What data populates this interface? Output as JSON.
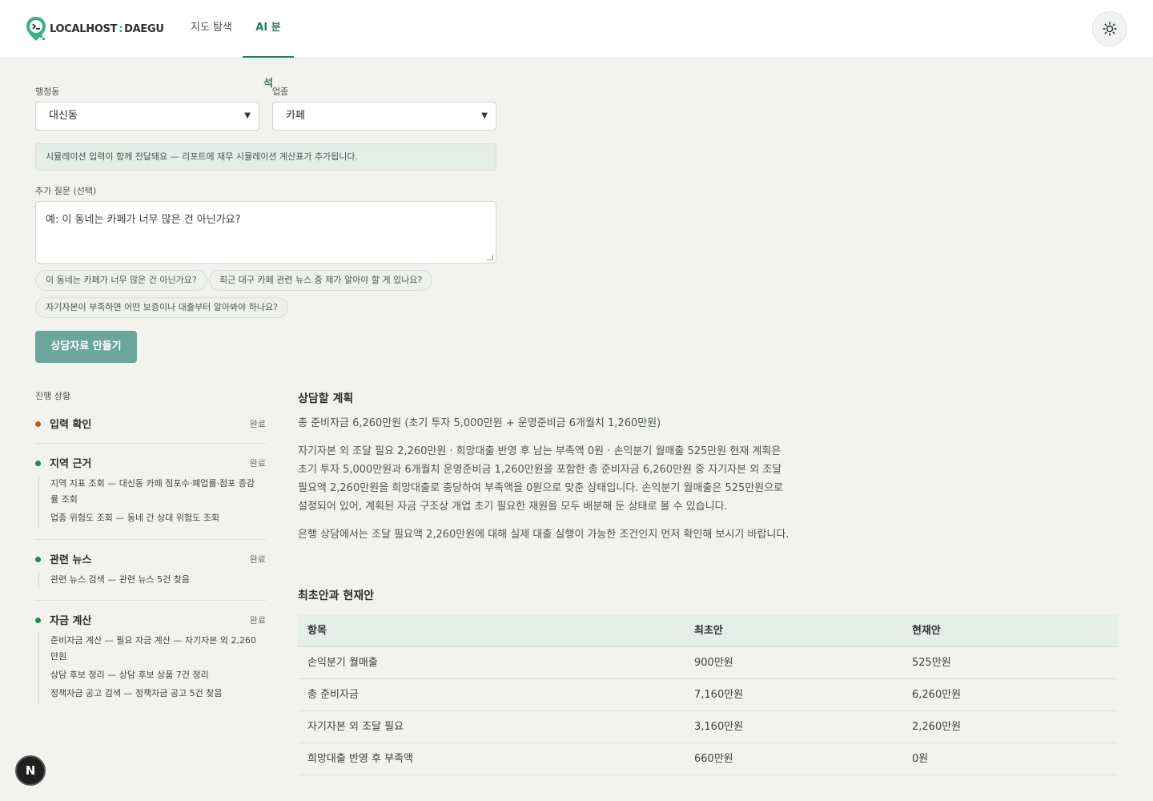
{
  "header": {
    "logo_left": "LOCALHOST",
    "logo_sep": ":",
    "logo_right": "DAEGU",
    "tabs": [
      {
        "label": "지도 탐색"
      },
      {
        "label": "AI 분석"
      }
    ]
  },
  "form": {
    "district_label": "행정동",
    "district_value": "대신동",
    "business_label": "업종",
    "business_value": "카페",
    "info_text": "시뮬레이션 입력이 함께 전달돼요 — 리포트에 재무 시뮬레이션 계산표가 추가됩니다.",
    "question_label": "추가 질문 (선택)",
    "question_placeholder": "예: 이 동네는 카페가 너무 많은 건 아닌가요?",
    "chips": [
      "이 동네는 카페가 너무 많은 건 아닌가요?",
      "최근 대구 카페 관련 뉴스 중 제가 알아야 할 게 있나요?",
      "자기자본이 부족하면 어떤 보증이나 대출부터 알아봐야 하나요?"
    ],
    "submit_label": "상담자료 만들기"
  },
  "progress": {
    "title": "진행 상황",
    "steps": [
      {
        "name": "입력 확인",
        "status": "완료",
        "color": "#b65a14",
        "items": []
      },
      {
        "name": "지역 근거",
        "status": "완료",
        "color": "#1f8a4c",
        "items": [
          "지역 지표 조회 — 대신동 카페 점포수·폐업률·점포 증감률 조회",
          "업종 위험도 조회 — 동네 간 상대 위험도 조회"
        ]
      },
      {
        "name": "관련 뉴스",
        "status": "완료",
        "color": "#1f8a4c",
        "items": [
          "관련 뉴스 검색 — 관련 뉴스 5건 찾음"
        ]
      },
      {
        "name": "자금 계산",
        "status": "완료",
        "color": "#1f8a4c",
        "items": [
          "준비자금 계산 — 필요 자금 계산 — 자기자본 외 2,260만원",
          "상담 후보 정리 — 상담 후보 상품 7건 정리",
          "정책자금 공고 검색 — 정책자금 공고 5건 찾음"
        ]
      }
    ]
  },
  "plan": {
    "title": "상담할 계획",
    "summary": "총 준비자금 6,260만원 (초기 투자 5,000만원 + 운영준비금 6개월치 1,260만원)",
    "body": "자기자본 외 조달 필요 2,260만원 · 희망대출 반영 후 남는 부족액 0원 · 손익분기 월매출 525만원 현재 계획은 초기 투자 5,000만원과 6개월치 운영준비금 1,260만원을 포함한 총 준비자금 6,260만원 중 자기자본 외 조달 필요액 2,260만원을 희망대출로 충당하여 부족액을 0원으로 맞춘 상태입니다. 손익분기 월매출은 525만원으로 설정되어 있어, 계획된 자금 구조상 개업 초기 필요한 재원을 모두 배분해 둔 상태로 볼 수 있습니다.",
    "advice": "은행 상담에서는 조달 필요액 2,260만원에 대해 실제 대출 실행이 가능한 조건인지 먼저 확인해 보시기 바랍니다."
  },
  "comparison": {
    "title": "최초안과 현재안",
    "headers": [
      "항목",
      "최초안",
      "현재안"
    ],
    "rows": [
      [
        "손익분기 월매출",
        "900만원",
        "525만원"
      ],
      [
        "총 준비자금",
        "7,160만원",
        "6,260만원"
      ],
      [
        "자기자본 외 조달 필요",
        "3,160만원",
        "2,260만원"
      ],
      [
        "희망대출 반영 후 부족액",
        "660만원",
        "0원"
      ]
    ]
  },
  "badge": {
    "letter": "N"
  },
  "colors": {
    "accent": "#2c7a63",
    "button": "#6aa69a",
    "background": "#f2f3ef"
  }
}
